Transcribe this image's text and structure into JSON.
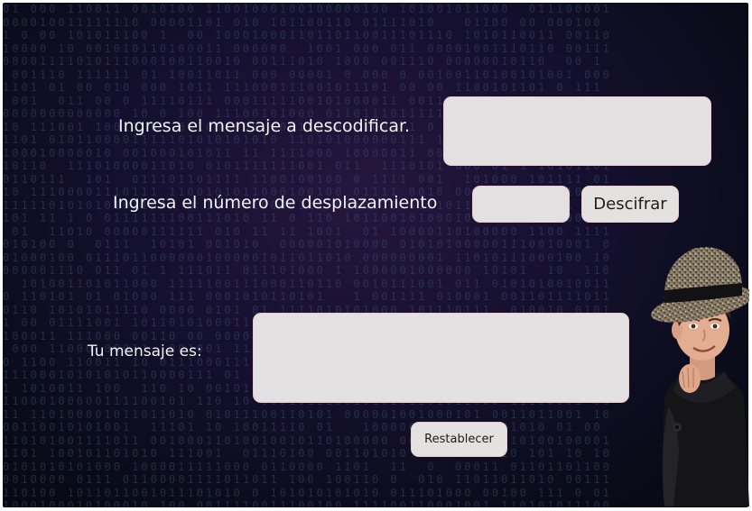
{
  "form": {
    "message_label": "Ingresa el mensaje a  descodificar.",
    "message_value": "",
    "shift_label": "Ingresa el  número de desplazamiento",
    "shift_value": "",
    "decrypt_button": "Descifrar",
    "result_label": "Tu mensaje es:",
    "result_value": "",
    "reset_button": "Restablecer"
  },
  "icons": {
    "character": "detective-kid-illustration"
  },
  "colors": {
    "background": "#161030",
    "field": "#e2e0e0",
    "field_border": "#f0c8cc",
    "label_text": "#f2f2f4"
  }
}
